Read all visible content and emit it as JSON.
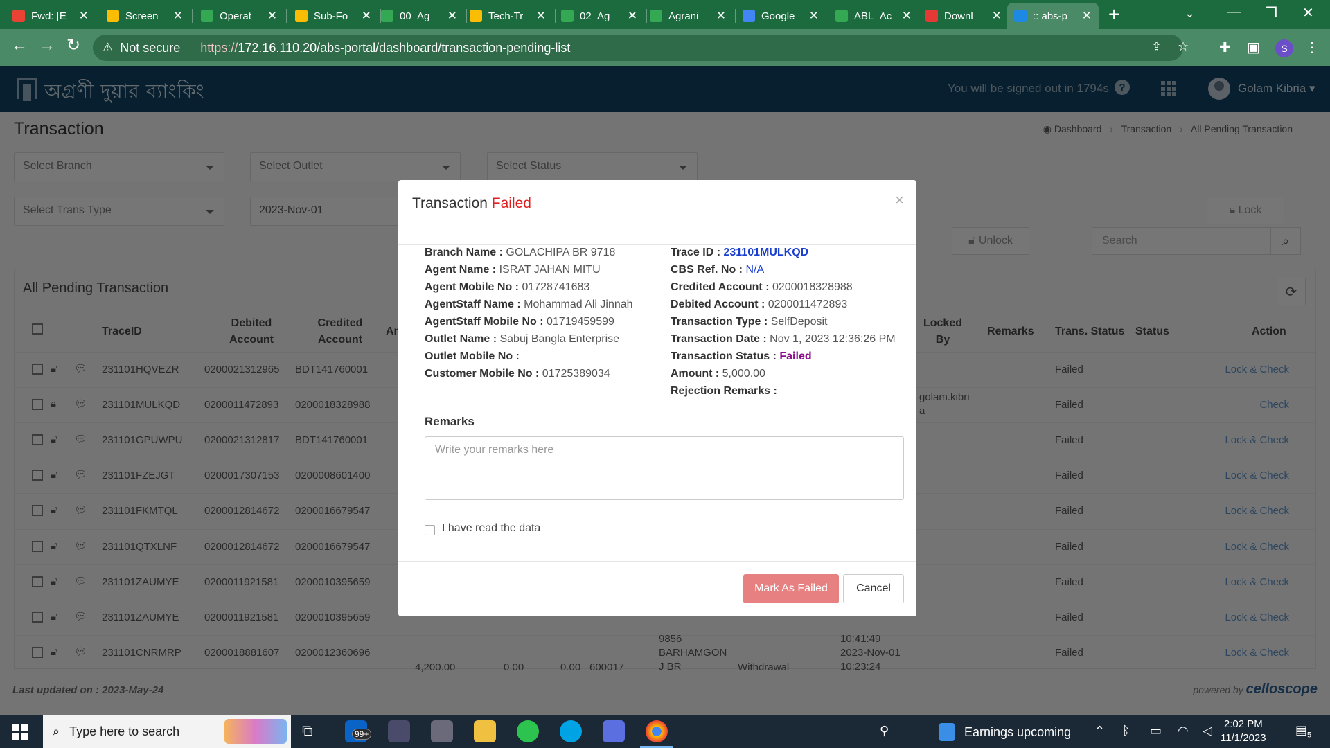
{
  "browser": {
    "tabs": [
      {
        "title": "Fwd: [E",
        "icon": "gmail-icon",
        "color": "#ea4335"
      },
      {
        "title": "Screen",
        "icon": "drive-icon",
        "color": "#fbbc04"
      },
      {
        "title": "Operat",
        "icon": "sheets-icon",
        "color": "#34a853"
      },
      {
        "title": "Sub-Fo",
        "icon": "drive-icon",
        "color": "#fbbc04"
      },
      {
        "title": "00_Ag",
        "icon": "sheets-icon",
        "color": "#34a853"
      },
      {
        "title": "Tech-Tr",
        "icon": "drive-icon",
        "color": "#fbbc04"
      },
      {
        "title": "02_Ag",
        "icon": "sheets-icon",
        "color": "#34a853"
      },
      {
        "title": "Agrani",
        "icon": "sheets-icon",
        "color": "#34a853"
      },
      {
        "title": "Google",
        "icon": "translate-icon",
        "color": "#4285f4"
      },
      {
        "title": "ABL_Ac",
        "icon": "sheets-icon",
        "color": "#34a853"
      },
      {
        "title": "Downl",
        "icon": "heart-icon",
        "color": "#e53935"
      },
      {
        "title": ":: abs-p",
        "icon": "page-icon",
        "color": "#1e88e5"
      }
    ],
    "security_label": "Not secure",
    "url_scheme": "https://",
    "url_rest": "172.16.110.20/abs-portal/dashboard/transaction-pending-list",
    "profile_initial": "S"
  },
  "app": {
    "logo_text": "অগ্রণী দুয়ার ব্যাংকিং",
    "signout_text": "You will be signed out in 1794s",
    "user_name": "Golam Kibria",
    "page_title": "Transaction",
    "breadcrumb": [
      "Dashboard",
      "Transaction",
      "All Pending Transaction"
    ]
  },
  "filters": {
    "branch_placeholder": "Select Branch",
    "outlet_placeholder": "Select Outlet",
    "status_placeholder": "Select Status",
    "trans_type_placeholder": "Select Trans Type",
    "date_value": "2023-Nov-01",
    "lock_label": "Lock",
    "unlock_label": "Unlock",
    "search_placeholder": "Search"
  },
  "table": {
    "title": "All Pending Transaction",
    "headers": {
      "trace_id": "TraceID",
      "debited": [
        "Debited",
        "Account"
      ],
      "credited": [
        "Credited",
        "Account"
      ],
      "amount_partial": "An",
      "locked_by": [
        "Locked",
        "By"
      ],
      "remarks": "Remarks",
      "trans_status": "Trans. Status",
      "status": "Status",
      "action": "Action"
    },
    "rows": [
      {
        "trace": "231101HQVEZR",
        "debited": "0200021312965",
        "credited": "BDT141760001",
        "trans_status": "Failed",
        "action": "Lock & Check",
        "locked": false,
        "locked_by": [
          "",
          ""
        ]
      },
      {
        "trace": "231101MULKQD",
        "debited": "0200011472893",
        "credited": "0200018328988",
        "trans_status": "Failed",
        "action": "Check",
        "locked": true,
        "locked_by": [
          "golam.kibri",
          "a"
        ]
      },
      {
        "trace": "231101GPUWPU",
        "debited": "0200021312817",
        "credited": "BDT141760001",
        "trans_status": "Failed",
        "action": "Lock & Check",
        "locked": false,
        "locked_by": [
          "",
          ""
        ]
      },
      {
        "trace": "231101FZEJGT",
        "debited": "0200017307153",
        "credited": "0200008601400",
        "trans_status": "Failed",
        "action": "Lock & Check",
        "locked": false,
        "locked_by": [
          "",
          ""
        ]
      },
      {
        "trace": "231101FKMTQL",
        "debited": "0200012814672",
        "credited": "0200016679547",
        "trans_status": "Failed",
        "action": "Lock & Check",
        "locked": false,
        "locked_by": [
          "",
          ""
        ]
      },
      {
        "trace": "231101QTXLNF",
        "debited": "0200012814672",
        "credited": "0200016679547",
        "trans_status": "Failed",
        "action": "Lock & Check",
        "locked": false,
        "locked_by": [
          "",
          ""
        ]
      },
      {
        "trace": "231101ZAUMYE",
        "debited": "0200011921581",
        "credited": "0200010395659",
        "trans_status": "Failed",
        "action": "Lock & Check",
        "locked": false,
        "locked_by": [
          "",
          ""
        ]
      },
      {
        "trace": "231101ZAUMYE",
        "debited": "0200011921581",
        "credited": "0200010395659",
        "trans_status": "Failed",
        "action": "Lock & Check",
        "locked": false,
        "locked_by": [
          "",
          ""
        ]
      },
      {
        "trace": "231101CNRMRP",
        "debited": "0200018881607",
        "credited": "0200012360696",
        "trans_status": "Failed",
        "action": "Lock & Check",
        "locked": false,
        "locked_by": [
          "",
          ""
        ]
      }
    ],
    "row8_extra": {
      "col_a": "9856",
      "time": "10:41:49"
    },
    "row9_extra": {
      "amount": "4,200.00",
      "charge": "0.00",
      "vat": "0.00",
      "code": "600017",
      "branch": [
        "BARHAMGON",
        "J BR"
      ],
      "type": "Withdrawal",
      "date": "2023-Nov-01",
      "time": "10:23:24"
    }
  },
  "footer": {
    "last_updated": "Last updated on : 2023-May-24",
    "powered_by": "powered by",
    "brand": "celloscope"
  },
  "modal": {
    "title_prefix": "Transaction",
    "title_status": "Failed",
    "left": [
      {
        "label": "Branch Name :",
        "value": "GOLACHIPA BR 9718"
      },
      {
        "label": "Agent Name :",
        "value": "ISRAT JAHAN MITU"
      },
      {
        "label": "Agent Mobile No :",
        "value": "01728741683"
      },
      {
        "label": "AgentStaff Name :",
        "value": "Mohammad Ali Jinnah"
      },
      {
        "label": "AgentStaff Mobile No :",
        "value": "01719459599"
      },
      {
        "label": "Outlet Name :",
        "value": "Sabuj Bangla Enterprise"
      },
      {
        "label": "Outlet Mobile No :",
        "value": ""
      },
      {
        "label": "Customer Mobile No :",
        "value": "01725389034"
      }
    ],
    "right": [
      {
        "label": "Trace ID :",
        "value": "231101MULKQD"
      },
      {
        "label": "CBS Ref. No :",
        "value": "N/A"
      },
      {
        "label": "Credited Account :",
        "value": "0200018328988"
      },
      {
        "label": "Debited Account :",
        "value": "0200011472893"
      },
      {
        "label": "Transaction Type :",
        "value": "SelfDeposit"
      },
      {
        "label": "Transaction Date :",
        "value": "Nov 1, 2023 12:36:26 PM"
      },
      {
        "label": "Transaction Status :",
        "value": "Failed"
      },
      {
        "label": "Amount :",
        "value": "5,000.00"
      },
      {
        "label": "Rejection Remarks :",
        "value": ""
      }
    ],
    "remarks_label": "Remarks",
    "remarks_placeholder": "Write your remarks here",
    "read_label": "I have read the data",
    "mark_failed_label": "Mark As Failed",
    "cancel_label": "Cancel"
  },
  "taskbar": {
    "search_placeholder": "Type here to search",
    "mail_badge": "99+",
    "weather_text": "Earnings upcoming",
    "time": "2:02 PM",
    "date": "11/1/2023",
    "notif_count": "5"
  },
  "colors": {
    "tab_bar": "#1c6b3e",
    "toolbar": "#4b8a66",
    "app_header": "#0f3f5d",
    "failed_red": "#e02020",
    "mark_failed_btn": "#e78080",
    "link_blue": "#5b8ec1"
  }
}
